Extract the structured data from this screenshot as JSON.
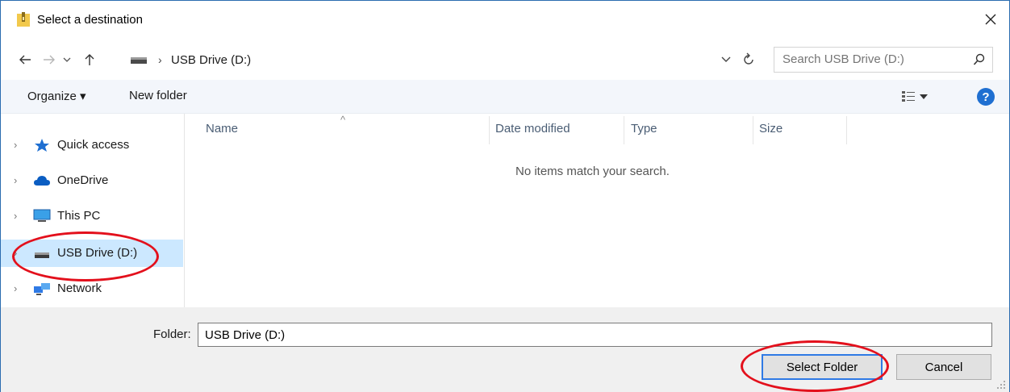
{
  "window": {
    "title": "Select a destination"
  },
  "address": {
    "path_label": "USB Drive (D:)",
    "search_placeholder": "Search USB Drive (D:)"
  },
  "toolbar": {
    "organize_label": "Organize ▾",
    "new_folder_label": "New folder"
  },
  "nav": {
    "items": [
      {
        "label": "Quick access",
        "icon": "star-icon"
      },
      {
        "label": "OneDrive",
        "icon": "cloud-icon"
      },
      {
        "label": "This PC",
        "icon": "computer-icon"
      },
      {
        "label": "USB Drive (D:)",
        "icon": "drive-icon",
        "selected": true
      },
      {
        "label": "Network",
        "icon": "network-icon"
      }
    ]
  },
  "content": {
    "columns": [
      "Name",
      "Date modified",
      "Type",
      "Size"
    ],
    "empty_message": "No items match your search."
  },
  "bottom": {
    "folder_label": "Folder:",
    "folder_value": "USB Drive (D:)",
    "select_folder_label": "Select Folder",
    "cancel_label": "Cancel"
  },
  "colors": {
    "selection": "#cce8ff",
    "annotation": "#e3101c",
    "help": "#1f6fd1"
  }
}
